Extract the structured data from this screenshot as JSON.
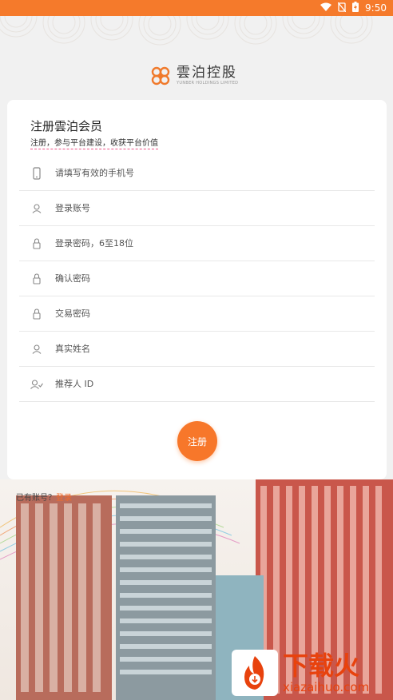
{
  "status_bar": {
    "time": "9:50"
  },
  "logo": {
    "name_cn": "雲泊控股",
    "name_en": "YUNBER HOLDINGS LIMITED"
  },
  "form": {
    "title": "注册雲泊会员",
    "subtitle": "注册，参与平台建设，收获平台价值",
    "fields": [
      {
        "placeholder": "请填写有效的手机号",
        "icon": "phone-icon"
      },
      {
        "placeholder": "登录账号",
        "icon": "user-icon"
      },
      {
        "placeholder": "登录密码，6至18位",
        "icon": "lock-icon"
      },
      {
        "placeholder": "确认密码",
        "icon": "lock-icon"
      },
      {
        "placeholder": "交易密码",
        "icon": "lock-icon"
      },
      {
        "placeholder": "真实姓名",
        "icon": "user-icon"
      },
      {
        "placeholder": "推荐人 ID",
        "icon": "user-check-icon"
      }
    ],
    "register_label": "注册"
  },
  "login_prompt": {
    "text": "已有账号？",
    "link": "登录"
  },
  "watermark": {
    "cn": "下载火",
    "en": "xiazaihuo.com"
  },
  "colors": {
    "accent": "#f7772a",
    "status_bar": "#f57a2b"
  }
}
